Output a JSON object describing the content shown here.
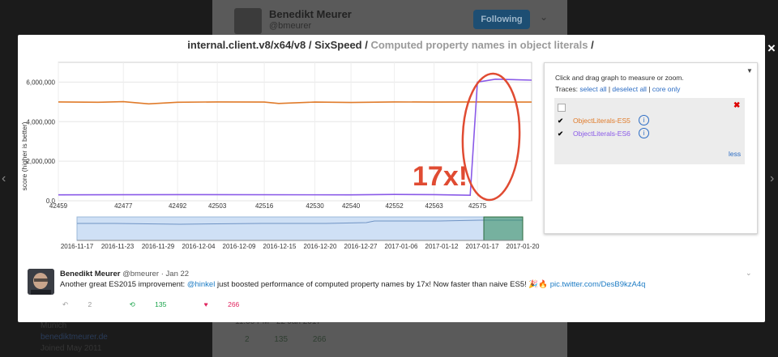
{
  "background": {
    "name": "Benedikt Meurer",
    "handle": "@bmeurer",
    "follow_label": "Following",
    "location": "Munich",
    "website": "benediktmeurer.de",
    "joined": "Joined May 2011",
    "date": "11:00 PM - 22 Jan 2017",
    "replies": "2",
    "retweets": "135",
    "likes": "266"
  },
  "modal": {
    "close_icon": "×",
    "title": {
      "path": "internal.client.v8/x64/v8",
      "sep1": " / ",
      "suite": "SixSpeed",
      "sep2": " / ",
      "test": "Computed property names in object literals",
      "sep3": " /"
    }
  },
  "panel": {
    "help_text": "Click and drag graph to measure or zoom.",
    "traces_label": "Traces:",
    "select_all": "select all",
    "deselect_all": "deselect all",
    "core_only": "core only",
    "less": "less",
    "traces": [
      {
        "name": "ObjectLiterals-ES5",
        "checked": "✔",
        "color": "#e07b2a"
      },
      {
        "name": "ObjectLiterals-ES6",
        "checked": "✔",
        "color": "#8a5ae8"
      }
    ]
  },
  "chart_data": {
    "type": "line",
    "ylabel": "score (higher is better)",
    "ylim": [
      0,
      7000000
    ],
    "y_ticks": [
      "0.0",
      "2,000,000",
      "4,000,000",
      "6,000,000"
    ],
    "x_ticks": [
      "42459",
      "42477",
      "42492",
      "42503",
      "42516",
      "42530",
      "42540",
      "42552",
      "42563",
      "42575"
    ],
    "overview_dates": [
      "2016-11-17",
      "2016-11-23",
      "2016-11-29",
      "2016-12-04",
      "2016-12-09",
      "2016-12-15",
      "2016-12-20",
      "2016-12-27",
      "2017-01-06",
      "2017-01-12",
      "2017-01-17",
      "2017-01-20"
    ],
    "annotation": "17x!",
    "series": [
      {
        "name": "ObjectLiterals-ES5",
        "color": "#e07b2a",
        "points": [
          [
            42459,
            5000000
          ],
          [
            42470,
            4980000
          ],
          [
            42477,
            5010000
          ],
          [
            42484,
            4900000
          ],
          [
            42492,
            4980000
          ],
          [
            42503,
            5000000
          ],
          [
            42516,
            4990000
          ],
          [
            42520,
            4920000
          ],
          [
            42530,
            4990000
          ],
          [
            42540,
            4970000
          ],
          [
            42552,
            5000000
          ],
          [
            42563,
            4990000
          ],
          [
            42575,
            5000000
          ],
          [
            42590,
            4990000
          ]
        ]
      },
      {
        "name": "ObjectLiterals-ES6",
        "color": "#8a5ae8",
        "points": [
          [
            42459,
            300000
          ],
          [
            42492,
            310000
          ],
          [
            42540,
            300000
          ],
          [
            42552,
            320000
          ],
          [
            42563,
            310000
          ],
          [
            42573,
            280000
          ],
          [
            42575,
            6000000
          ],
          [
            42580,
            6150000
          ],
          [
            42590,
            6100000
          ]
        ]
      }
    ]
  },
  "tweet": {
    "name": "Benedikt Meurer",
    "handle": "@bmeurer",
    "date": "· Jan 22",
    "text_before": "Another great ES2015 improvement: ",
    "mention": "@hinkel",
    "text_after": " just boosted performance of computed property names by 17x! Now faster than naive ES5! 🎉🔥 ",
    "pic_link": "pic.twitter.com/DesB9kzA4q",
    "replies": "2",
    "retweets": "135",
    "likes": "266"
  }
}
